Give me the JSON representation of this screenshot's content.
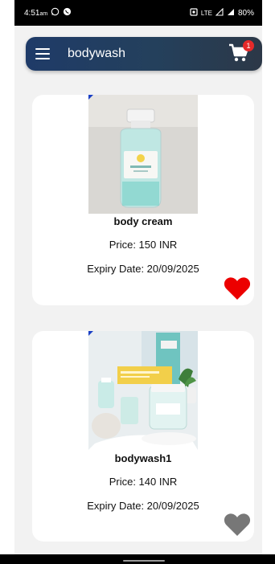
{
  "status_bar": {
    "time": "4:51",
    "time_suffix": "am",
    "network": "LTE",
    "battery": "80%",
    "left_icons": [
      "whatsapp-icon",
      "whatsapp-business-icon"
    ],
    "right_icons": [
      "sim-icon",
      "signal-icon",
      "signal-icon"
    ]
  },
  "toolbar": {
    "title": "bodywash",
    "cart_count": "1",
    "colors": {
      "gradient_start": "#1f3b68",
      "gradient_end": "#2c3847"
    }
  },
  "products": [
    {
      "name": "body cream",
      "price": "Price: 150 INR",
      "expiry": "Expiry Date: 20/09/2025",
      "favorite": true,
      "heart_color": "#ec0000"
    },
    {
      "name": "bodywash1",
      "price": "Price: 140 INR",
      "expiry": "Expiry Date: 20/09/2025",
      "favorite": false,
      "heart_color": "#777777"
    }
  ]
}
